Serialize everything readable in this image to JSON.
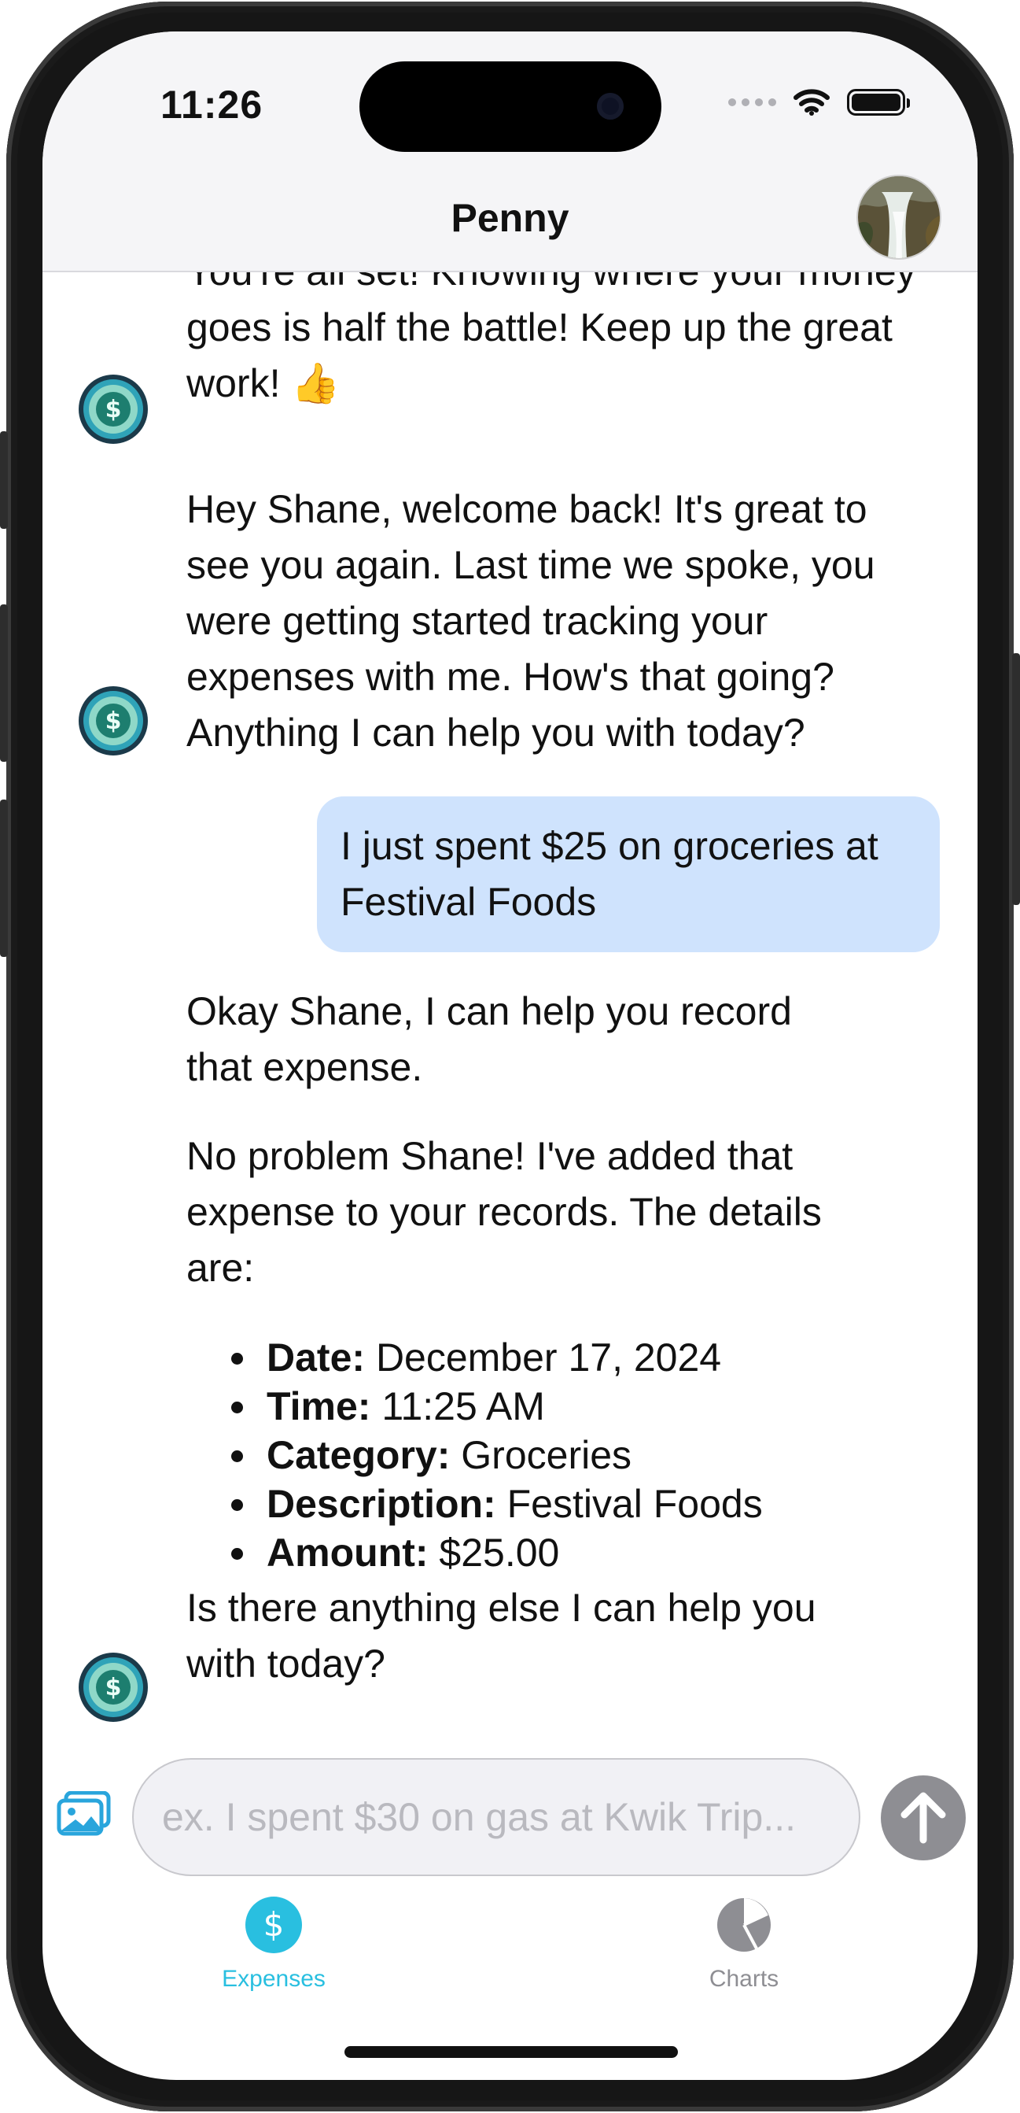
{
  "status_bar": {
    "time": "11:26"
  },
  "nav": {
    "title": "Penny"
  },
  "messages": {
    "m1": "You're all set!  Knowing where your money goes is half the battle! Keep up the great work! 👍",
    "m2": "Hey Shane, welcome back!  It's great to see you again. Last time we spoke, you were getting started tracking your expenses with me. How's that going? Anything I can help you with today?",
    "user": "I just spent $25 on groceries at Festival Foods",
    "m3": "Okay Shane, I can help you record that expense.",
    "m4": "No problem Shane! I've added that expense to your records.  The details are:",
    "details": [
      {
        "label": "Date:",
        "value": "December 17, 2024"
      },
      {
        "label": "Time:",
        "value": "11:25 AM"
      },
      {
        "label": "Category:",
        "value": "Groceries"
      },
      {
        "label": "Description:",
        "value": "Festival Foods"
      },
      {
        "label": "Amount:",
        "value": "$25.00"
      }
    ],
    "m5": "Is there anything else I can help you with today?"
  },
  "composer": {
    "placeholder": "ex. I spent $30 on gas at Kwik Trip..."
  },
  "tabs": [
    {
      "label": "Expenses",
      "icon": "dollar-circle-icon",
      "active": true
    },
    {
      "label": "Charts",
      "icon": "pie-chart-icon",
      "active": false
    }
  ],
  "colors": {
    "accent": "#29bfe0",
    "user_bubble": "#cfe3fd",
    "send_button": "#8e8e93",
    "inactive_tab": "#8e8e93"
  }
}
